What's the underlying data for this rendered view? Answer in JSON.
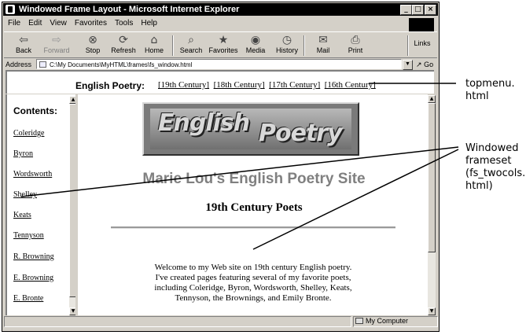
{
  "window": {
    "title": "Windowed Frame Layout - Microsoft Internet Explorer",
    "min": "_",
    "max": "□",
    "close": "×"
  },
  "menubar": [
    "File",
    "Edit",
    "View",
    "Favorites",
    "Tools",
    "Help"
  ],
  "toolbar": {
    "back": "Back",
    "forward": "Forward",
    "stop": "Stop",
    "refresh": "Refresh",
    "home": "Home",
    "search": "Search",
    "favorites": "Favorites",
    "media": "Media",
    "history": "History",
    "mail": "Mail",
    "print": "Print",
    "links": "Links"
  },
  "address": {
    "label": "Address",
    "value": "C:\\My Documents\\MyHTML\\frames\\fs_window.html",
    "go": "Go"
  },
  "topframe": {
    "label": "English Poetry:",
    "links": [
      "[19th Century]",
      "[18th Century]",
      "[17th Century]",
      "[16th Century]"
    ]
  },
  "leftframe": {
    "heading": "Contents:",
    "links": [
      "Coleridge",
      "Byron",
      "Wordsworth",
      "Shelley",
      "Keats",
      "Tennyson",
      "R. Browning",
      "E. Browning",
      "E. Bronte"
    ]
  },
  "mainframe": {
    "banner_word1": "English",
    "banner_word2": "Poetry",
    "site_title": "Marie Lou's English Poetry Site",
    "section_heading": "19th Century Poets",
    "welcome_lines": [
      "Welcome to my Web site on 19th century English poetry.",
      "I've created pages featuring several of my favorite poets,",
      "including Coleridge, Byron, Wordsworth, Shelley, Keats,",
      "Tennyson, the Brownings, and Emily Bronte."
    ]
  },
  "statusbar": {
    "zone": "My Computer"
  },
  "callouts": {
    "top": [
      "topmenu.",
      "html"
    ],
    "frameset": [
      "Windowed",
      "frameset",
      "(fs_twocols.",
      "html)"
    ]
  }
}
